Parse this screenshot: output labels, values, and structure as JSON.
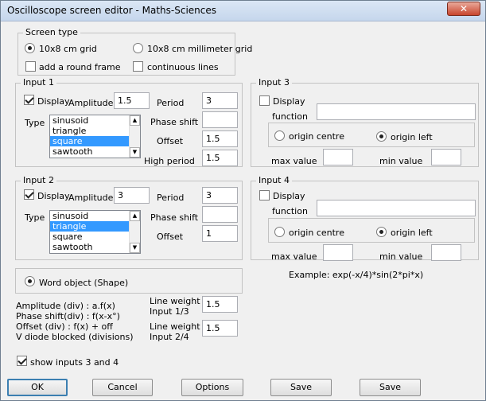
{
  "window": {
    "title": "Oscilloscope screen editor - Maths-Sciences",
    "close_glyph": "✕"
  },
  "screen_type": {
    "label": "Screen type",
    "opt_cm_grid": "10x8 cm grid",
    "opt_mm_grid": "10x8 cm millimeter grid",
    "round_frame": "add a round frame",
    "continuous_lines": "continuous lines",
    "selected": "10x8 cm grid"
  },
  "input1": {
    "label": "Input 1",
    "display": "Display",
    "amplitude_label": "Amplitude",
    "amplitude": "1.5",
    "period_label": "Period",
    "period": "3",
    "type_label": "Type",
    "types": [
      "sinusoid",
      "triangle",
      "square",
      "sawtooth"
    ],
    "selected_type": "square",
    "phase_label": "Phase shift",
    "phase": "",
    "offset_label": "Offset",
    "offset": "1.5",
    "high_period_label": "High period",
    "high_period": "1.5"
  },
  "input2": {
    "label": "Input 2",
    "display": "Display",
    "amplitude_label": "Amplitude",
    "amplitude": "3",
    "period_label": "Period",
    "period": "3",
    "type_label": "Type",
    "types": [
      "sinusoid",
      "triangle",
      "square",
      "sawtooth"
    ],
    "selected_type": "triangle",
    "phase_label": "Phase shift",
    "phase": "",
    "offset_label": "Offset",
    "offset": "1"
  },
  "input3": {
    "label": "Input 3",
    "display": "Display",
    "function_label": "function",
    "function": "",
    "origin_centre": "origin centre",
    "origin_left": "origin left",
    "max_label": "max value",
    "max": "",
    "min_label": "min value",
    "min": ""
  },
  "input4": {
    "label": "Input 4",
    "display": "Display",
    "function_label": "function",
    "function": "",
    "origin_centre": "origin centre",
    "origin_left": "origin left",
    "max_label": "max value",
    "max": "",
    "min_label": "min value",
    "min": ""
  },
  "example": "Example: exp(-x/4)*sin(2*pi*x)",
  "word_object": "Word object (Shape)",
  "notes": [
    "Amplitude (div)   : a.f(x)",
    "Phase shift(div)  : f(x-x°)",
    "Offset (div) : f(x) + off",
    "V diode blocked (divisions)"
  ],
  "line_weight13": {
    "label1": "Line weight",
    "label2": "Input 1/3",
    "value": "1.5"
  },
  "line_weight24": {
    "label1": "Line weight",
    "label2": "Input 2/4",
    "value": "1.5"
  },
  "show_inputs": "show inputs 3 and 4",
  "buttons": {
    "ok": "OK",
    "cancel": "Cancel",
    "options": "Options",
    "save1": "Save",
    "save2": "Save"
  }
}
